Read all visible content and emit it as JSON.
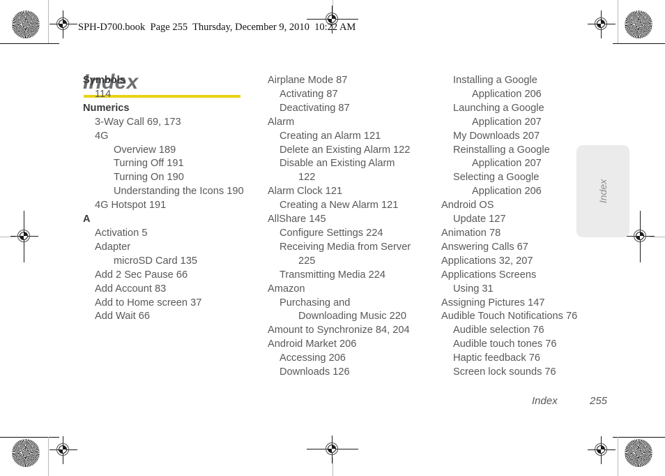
{
  "header": {
    "file_line": "SPH-D700.book  Page 255  Thursday, December 9, 2010  10:22 AM"
  },
  "page": {
    "title": "Index",
    "rule_color": "#e9d216"
  },
  "thumb_tab": {
    "label": "Index",
    "background": "#ebebeb"
  },
  "footer": {
    "label": "Index",
    "page_number": "255"
  },
  "columns": [
    {
      "id": "col-1",
      "entries": [
        {
          "text": "Symbols",
          "level": "head"
        },
        {
          "text": "114",
          "level": 1
        },
        {
          "text": "Numerics",
          "level": "head"
        },
        {
          "text": "3-Way Call 69, 173",
          "level": 1
        },
        {
          "text": "4G",
          "level": 1
        },
        {
          "text": "Overview 189",
          "level": 2
        },
        {
          "text": "Turning Off 191",
          "level": 2
        },
        {
          "text": "Turning On 190",
          "level": 2
        },
        {
          "text": "Understanding the Icons 190",
          "level": 2
        },
        {
          "text": "4G Hotspot 191",
          "level": 1
        },
        {
          "text": "A",
          "level": "head"
        },
        {
          "text": "Activation 5",
          "level": 1
        },
        {
          "text": "Adapter",
          "level": 1
        },
        {
          "text": "microSD Card 135",
          "level": 2
        },
        {
          "text": "Add 2 Sec Pause 66",
          "level": 1
        },
        {
          "text": "Add Account 83",
          "level": 1
        },
        {
          "text": "Add to Home screen 37",
          "level": 1
        },
        {
          "text": "Add Wait 66",
          "level": 1
        }
      ]
    },
    {
      "id": "col-2",
      "entries": [
        {
          "text": "Airplane Mode 87",
          "level": 0
        },
        {
          "text": "Activating 87",
          "level": 1
        },
        {
          "text": "Deactivating 87",
          "level": 1
        },
        {
          "text": "Alarm",
          "level": 0
        },
        {
          "text": "Creating an Alarm 121",
          "level": 1
        },
        {
          "text": "Delete an Existing Alarm 122",
          "level": 1
        },
        {
          "text": "Disable an Existing Alarm",
          "level": 1
        },
        {
          "text": "122",
          "level": 2
        },
        {
          "text": "Alarm Clock 121",
          "level": 0
        },
        {
          "text": "Creating a New Alarm 121",
          "level": 1
        },
        {
          "text": "AllShare 145",
          "level": 0
        },
        {
          "text": "Configure Settings 224",
          "level": 1
        },
        {
          "text": "Receiving Media from Server",
          "level": 1
        },
        {
          "text": "225",
          "level": 2
        },
        {
          "text": "Transmitting Media 224",
          "level": 1
        },
        {
          "text": "Amazon",
          "level": 0
        },
        {
          "text": "Purchasing and",
          "level": 1
        },
        {
          "text": "Downloading Music 220",
          "level": 2
        },
        {
          "text": "Amount to Synchronize 84, 204",
          "level": 0
        },
        {
          "text": "Android Market 206",
          "level": 0
        },
        {
          "text": "Accessing 206",
          "level": 1
        },
        {
          "text": "Downloads 126",
          "level": 1
        }
      ]
    },
    {
      "id": "col-3",
      "entries": [
        {
          "text": "Installing a Google",
          "level": 1
        },
        {
          "text": "Application 206",
          "level": 2
        },
        {
          "text": "Launching a Google",
          "level": 1
        },
        {
          "text": "Application 207",
          "level": 2
        },
        {
          "text": "My Downloads 207",
          "level": 1
        },
        {
          "text": "Reinstalling a Google",
          "level": 1
        },
        {
          "text": "Application 207",
          "level": 2
        },
        {
          "text": "Selecting a Google",
          "level": 1
        },
        {
          "text": "Application 206",
          "level": 2
        },
        {
          "text": "Android OS",
          "level": 0
        },
        {
          "text": "Update 127",
          "level": 1
        },
        {
          "text": "Animation 78",
          "level": 0
        },
        {
          "text": "Answering Calls 67",
          "level": 0
        },
        {
          "text": "Applications 32, 207",
          "level": 0
        },
        {
          "text": "Applications Screens",
          "level": 0
        },
        {
          "text": "Using 31",
          "level": 1
        },
        {
          "text": "Assigning Pictures 147",
          "level": 0
        },
        {
          "text": "Audible Touch Notifications 76",
          "level": 0
        },
        {
          "text": "Audible selection 76",
          "level": 1
        },
        {
          "text": "Audible touch tones 76",
          "level": 1
        },
        {
          "text": "Haptic feedback 76",
          "level": 1
        },
        {
          "text": "Screen lock sounds 76",
          "level": 1
        }
      ]
    }
  ]
}
